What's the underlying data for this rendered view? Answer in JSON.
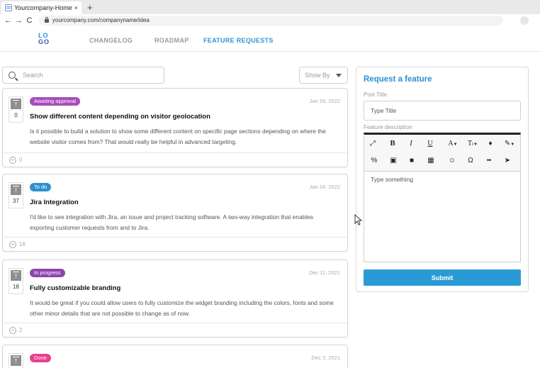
{
  "browser": {
    "tab_title": "Yourcompany-Home",
    "tab_close": "×",
    "new_tab": "+",
    "back": "←",
    "forward": "→",
    "reload": "C",
    "url": "yourcompany.com/companyname/idea"
  },
  "header": {
    "logo_top": "LO",
    "logo_bottom": "GO",
    "nav": [
      "CHANGELOG",
      "ROADMAP",
      "FEATURE REQUESTS"
    ],
    "active_nav": "FEATURE REQUESTS"
  },
  "controls": {
    "search_placeholder": "Search",
    "sort_label": "Show By"
  },
  "features": [
    {
      "status": "Awaiting approval",
      "status_color": "#a64db8",
      "votes": "0",
      "date": "Jan 26, 2022",
      "title": "Show different content depending on visitor geolocation",
      "description": "Is it possible to build a solution to show some different content on specific page sections depending on where the website visitor comes from? That would really be helpful in advanced targeting.",
      "comments": "0"
    },
    {
      "status": "To do",
      "status_color": "#2a90cf",
      "votes": "37",
      "date": "Jan 24, 2022",
      "title": "Jira Integration",
      "description": "I'd like to see integration with Jira, an issue and project tracking software. A two-way integration that enables exporting customer requests from and to Jira.",
      "comments": "16"
    },
    {
      "status": "In progress",
      "status_color": "#8e44ad",
      "votes": "18",
      "date": "Dec 11, 2021",
      "title": "Fully customizable branding",
      "description": "It would be great if you could allow users to fully customize the widget branding including the colors, fonts and some other minor details that are not possible to change as of now.",
      "comments": "2"
    },
    {
      "status": "Done",
      "status_color": "#e83e8c",
      "votes": "",
      "date": "Dec 2, 2021",
      "title": "",
      "description": "",
      "comments": ""
    }
  ],
  "request_form": {
    "title": "Request a feature",
    "post_title_label": "Post Title",
    "post_title_placeholder": "Type Title",
    "description_label": "Feature description",
    "editor_placeholder": "Type something",
    "submit_label": "Submit",
    "toolbar_icons": [
      "fullscreen-icon",
      "bold-icon",
      "italic-icon",
      "underline-icon",
      "font-color-icon",
      "font-size-icon",
      "fill-color-icon",
      "brush-icon",
      "link-icon",
      "image-icon",
      "video-icon",
      "table-icon",
      "emoji-icon",
      "special-char-icon",
      "horizontal-line-icon",
      "select-icon"
    ]
  }
}
